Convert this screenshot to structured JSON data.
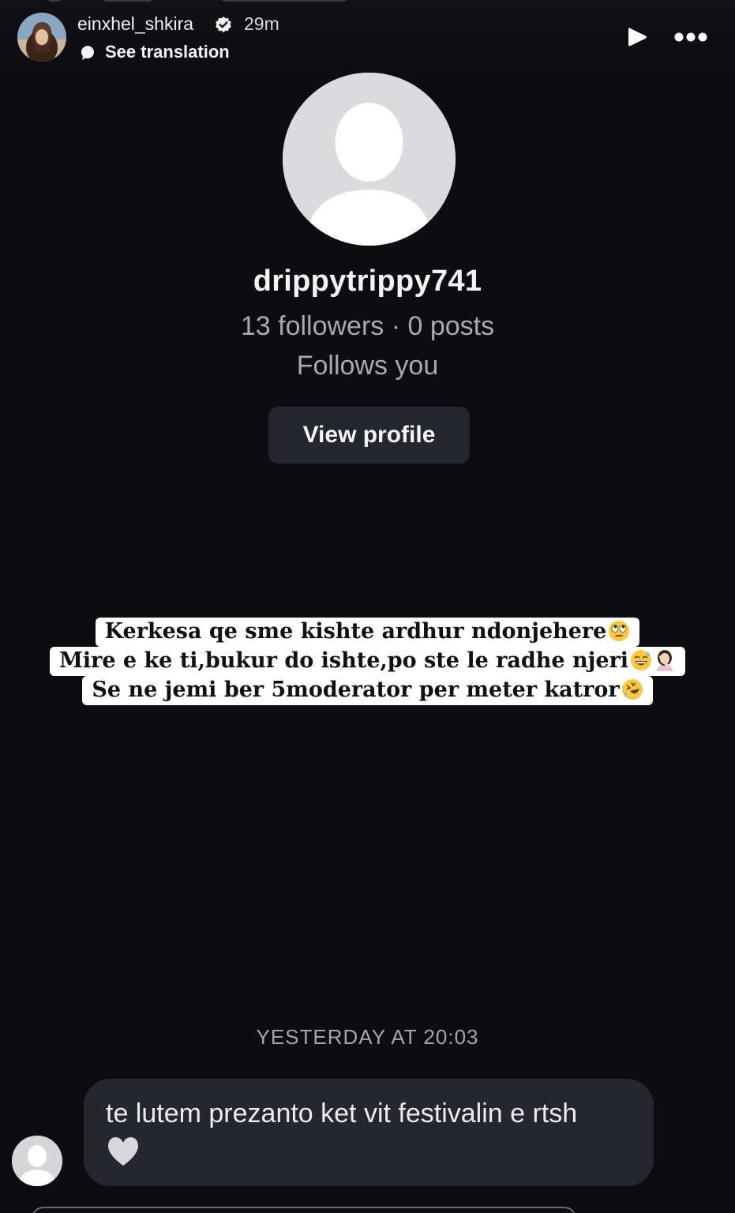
{
  "story": {
    "username": "einxhel_shkira",
    "time": "29m",
    "see_translation": "See translation"
  },
  "profile": {
    "username": "drippytrippy741",
    "stats": "13 followers · 0 posts",
    "follows_you": "Follows you",
    "view_profile": "View profile"
  },
  "caption": {
    "line1": "Kerkesa qe sme kishte ardhur ndonjehere",
    "line2": "Mire e ke ti,bukur do ishte,po ste le radhe njeri",
    "line3": "Se ne jemi ber 5moderator per meter katror"
  },
  "message": {
    "timestamp": "YESTERDAY AT 20:03",
    "text": "te lutem prezanto ket vit festivalin e rtsh"
  },
  "icons": {
    "verified": "verified-badge-icon",
    "translate": "translation-icon",
    "play": "play-icon",
    "more": "more-options-icon",
    "heart": "heart-icon"
  },
  "colors": {
    "background": "#0c0c11",
    "button": "#24262c",
    "bubble": "#26272c",
    "muted_text": "#a9a9ae"
  }
}
